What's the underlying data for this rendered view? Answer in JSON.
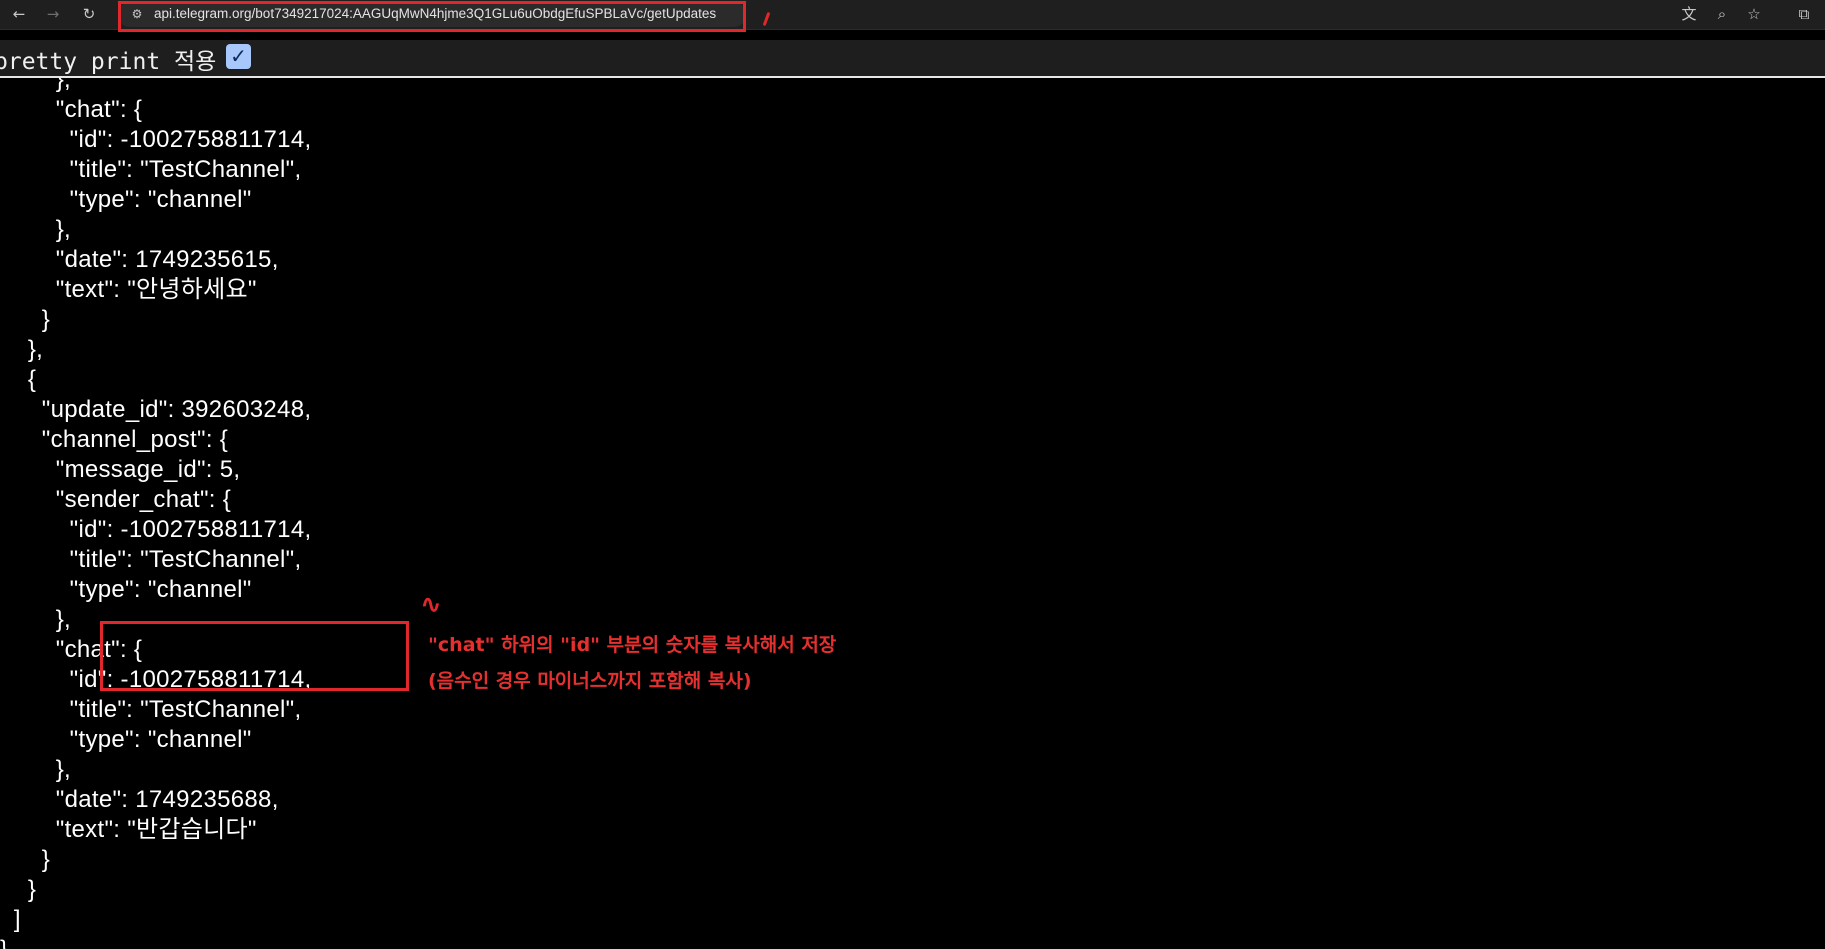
{
  "browser": {
    "back_icon": "arrow-left-icon",
    "forward_icon": "arrow-right-icon",
    "reload_icon": "reload-icon",
    "site_info_icon": "tune-icon",
    "url": "api.telegram.org/bot7349217024:AAGUqMwN4hjme3Q1GLu6uObdgEfuSPBLaVc/getUpdates",
    "right_icons": [
      "translate-icon",
      "zoom-icon",
      "star-icon",
      "extensions-icon"
    ]
  },
  "pretty_print": {
    "label": "pretty print 적용",
    "checked": true
  },
  "json_lines": [
    "        \"chat\": {",
    "          \"id\": -1002758811714,",
    "          \"title\": \"TestChannel\",",
    "          \"type\": \"channel\"",
    "        },",
    "        \"date\": 1749235615,",
    "        \"text\": \"안녕하세요\"",
    "      }",
    "    },",
    "    {",
    "      \"update_id\": 392603248,",
    "      \"channel_post\": {",
    "        \"message_id\": 5,",
    "        \"sender_chat\": {",
    "          \"id\": -1002758811714,",
    "          \"title\": \"TestChannel\",",
    "          \"type\": \"channel\"",
    "        },",
    "        \"chat\": {",
    "          \"id\": -1002758811714,",
    "          \"title\": \"TestChannel\",",
    "          \"type\": \"channel\"",
    "        },",
    "        \"date\": 1749235688,",
    "        \"text\": \"반갑습니다\"",
    "      }",
    "    }",
    "  ]",
    "}"
  ],
  "annotation": {
    "line1": "\"chat\" 하위의 \"id\" 부분의 숫자를 복사해서 저장",
    "line2": "(음수인 경우 마이너스까지 포함해 복사)",
    "color": "#e0272b"
  }
}
